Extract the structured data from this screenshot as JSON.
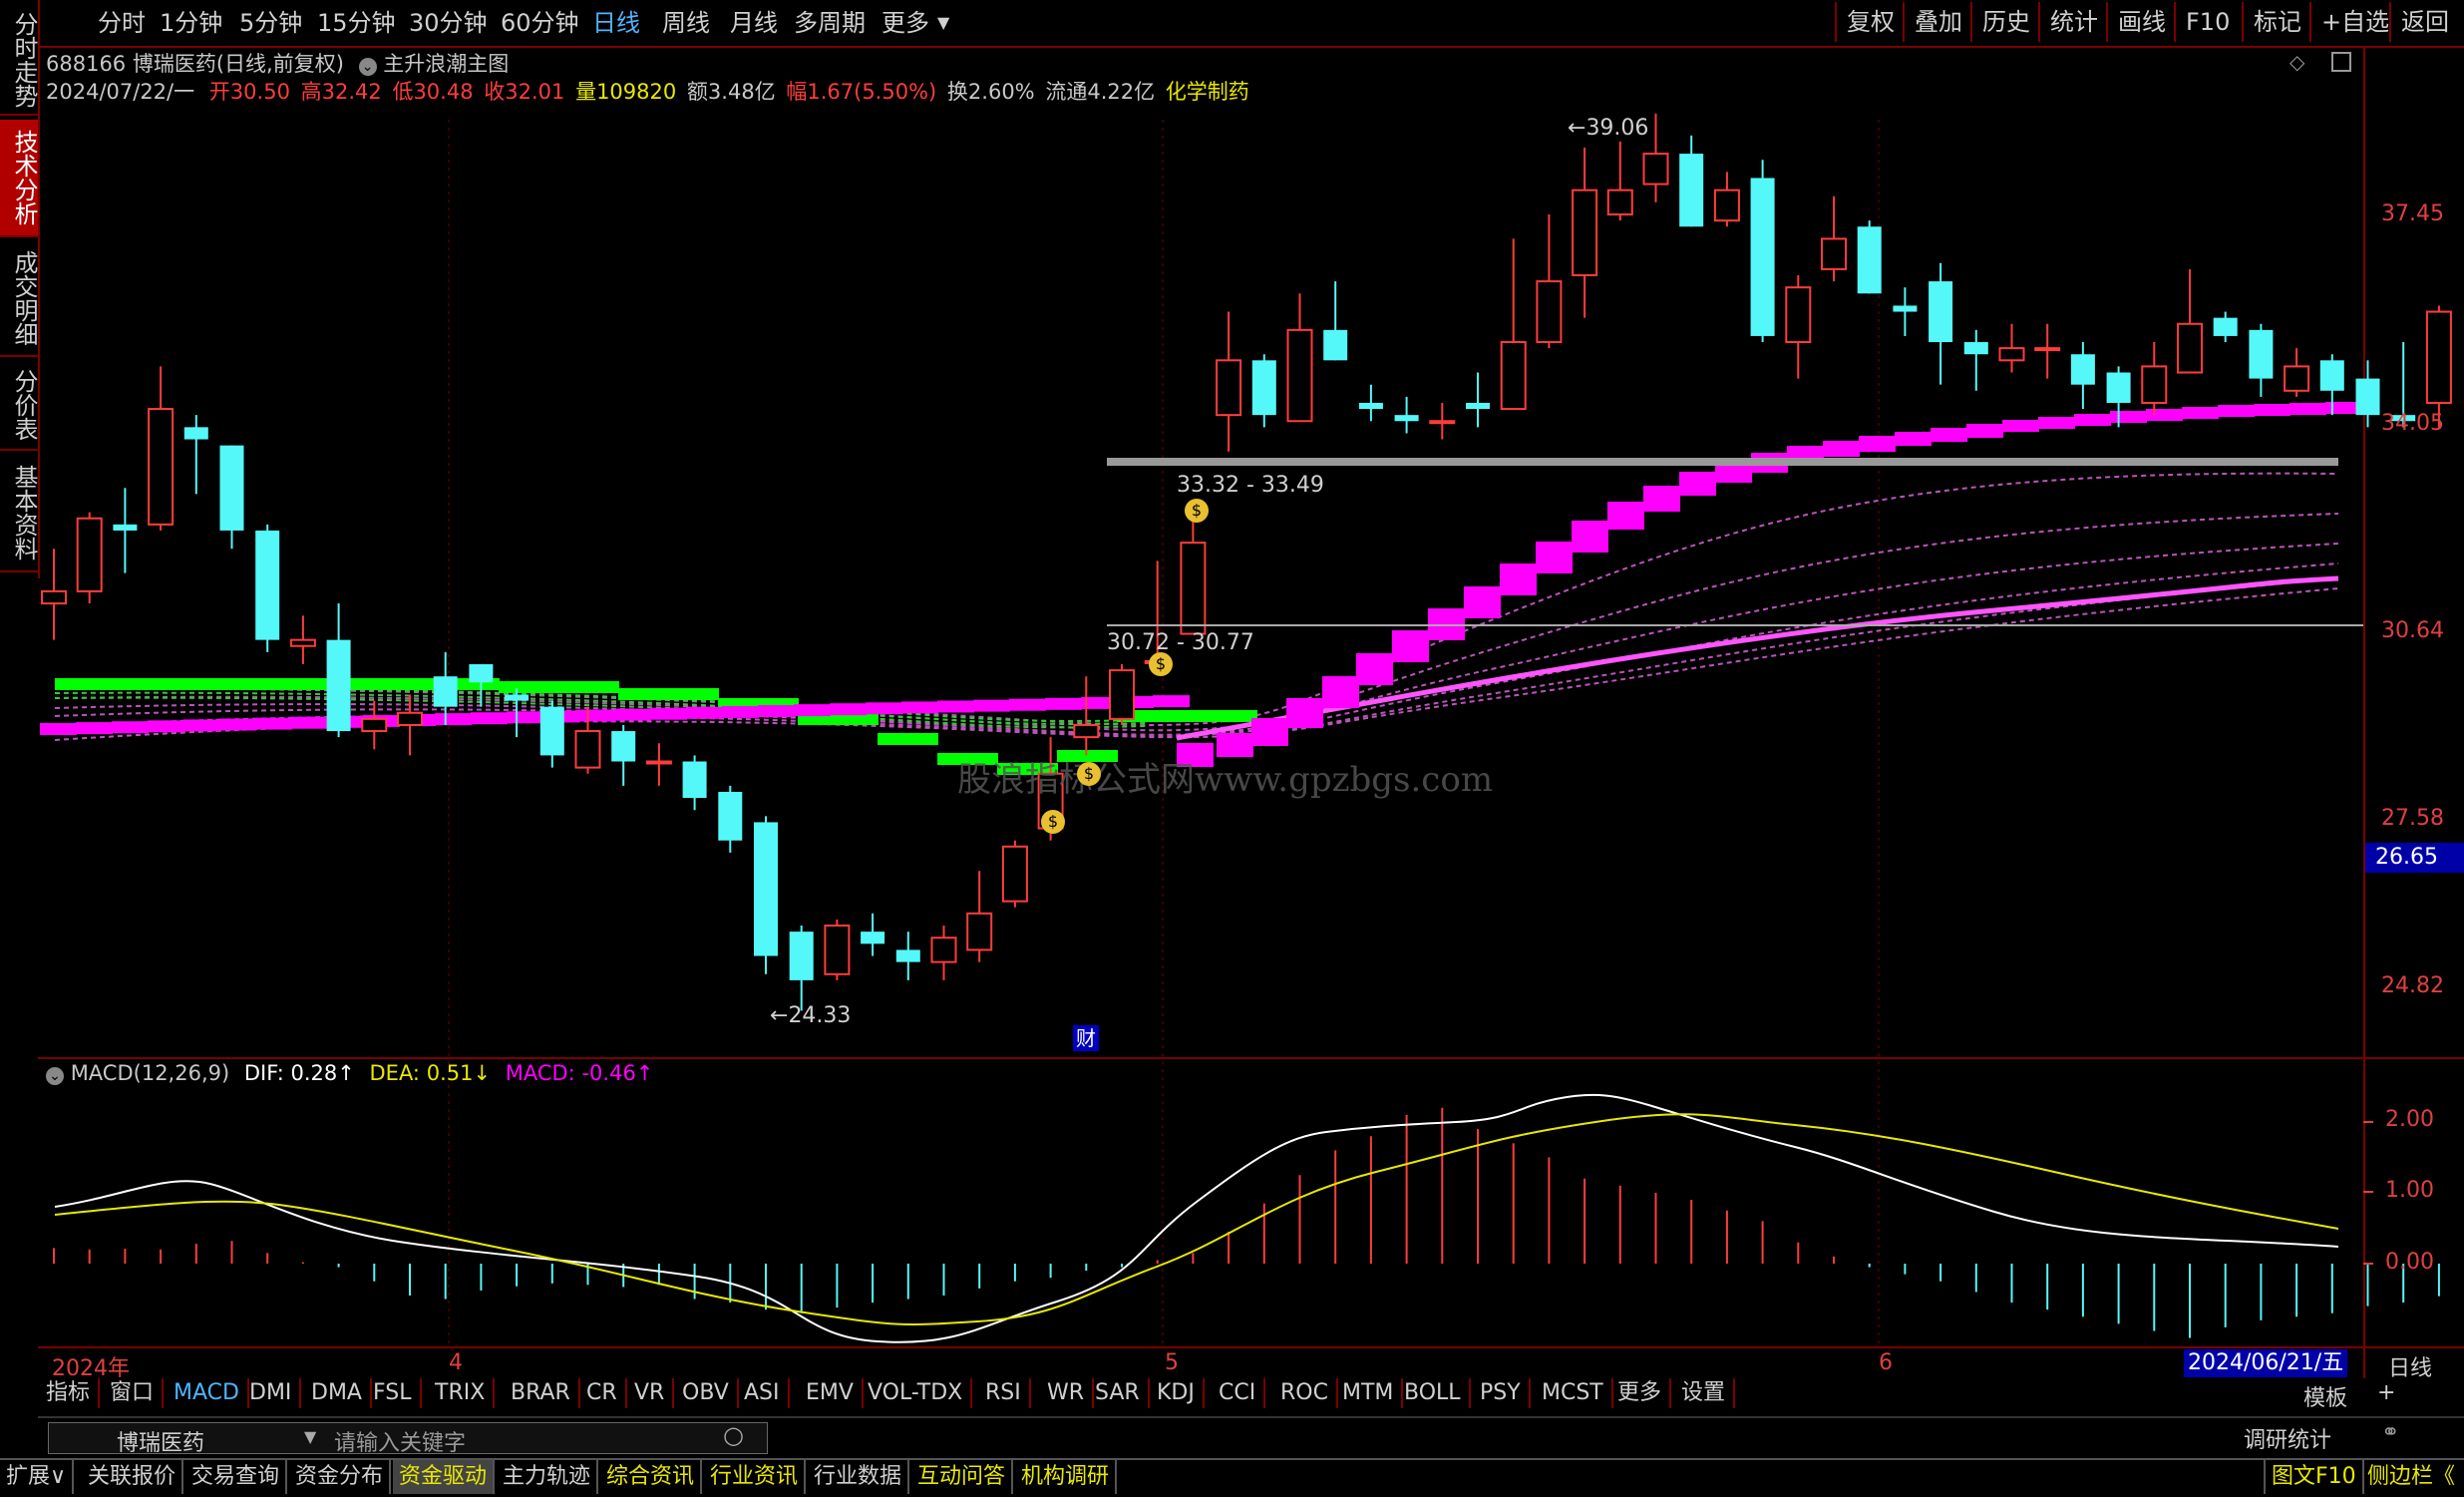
{
  "toolbar": {
    "left": [
      "分时",
      "1分钟",
      "5分钟",
      "15分钟",
      "30分钟",
      "60分钟",
      "日线",
      "周线",
      "月线",
      "多周期",
      "更多"
    ],
    "active": "日线",
    "right": [
      "复权",
      "叠加",
      "历史",
      "统计",
      "画线",
      "F10",
      "标记",
      "+自选",
      "返回"
    ]
  },
  "left_tabs": [
    "分时走势",
    "技术分析",
    "成交明细",
    "分价表",
    "基本资料"
  ],
  "left_tab_active": "技术分析",
  "stock": {
    "code_name": "688166 博瑞医药(日线,前复权)",
    "formula": "主升浪潮主图",
    "date": "2024/07/22/一",
    "open_label": "开",
    "open": "30.50",
    "high_label": "高",
    "high": "32.42",
    "low_label": "低",
    "low": "30.48",
    "close_label": "收",
    "close": "32.01",
    "vol_label": "量",
    "vol": "109820",
    "amt_label": "额",
    "amt": "3.48亿",
    "chg_label": "幅",
    "chg": "1.67(5.50%)",
    "turn_label": "换",
    "turn": "2.60%",
    "float_label": "流通",
    "float": "4.22亿",
    "sector": "化学制药"
  },
  "price_axis": [
    "37.45",
    "34.05",
    "30.64",
    "27.58",
    "24.82"
  ],
  "price_marker": "26.65",
  "annotations": {
    "high_label": "39.06",
    "low_label": "24.33",
    "range1": "33.32 - 33.49",
    "range2": "30.72 - 30.77",
    "cai": "财",
    "watermark": "股浪指标公式网www.gpzbgs.com"
  },
  "macd": {
    "title": "MACD(12,26,9)",
    "dif_label": "DIF:",
    "dif": "0.28↑",
    "dea_label": "DEA:",
    "dea": "0.51↓",
    "macd_label": "MACD:",
    "macd": "-0.46↑",
    "axis": [
      "2.00",
      "1.00",
      "0.00"
    ]
  },
  "time_axis": {
    "year": "2024年",
    "m4": "4",
    "m5": "5",
    "m6": "6",
    "cursor_date": "2024/06/21/五",
    "period": "日线"
  },
  "indicators": [
    "指标",
    "窗口",
    "MACD",
    "DMI",
    "DMA",
    "FSL",
    "TRIX",
    "BRAR",
    "CR",
    "VR",
    "OBV",
    "ASI",
    "EMV",
    "VOL-TDX",
    "RSI",
    "WR",
    "SAR",
    "KDJ",
    "CCI",
    "ROC",
    "MTM",
    "BOLL",
    "PSY",
    "MCST",
    "更多",
    "设置"
  ],
  "indicator_active": "MACD",
  "template_btn": "模板",
  "plus_btn": "+",
  "search": {
    "name": "博瑞医药",
    "placeholder": "请输入关键字",
    "right": "调研统计"
  },
  "bottom_tabs": [
    "扩展∨",
    "关联报价",
    "交易查询",
    "资金分布",
    "资金驱动",
    "主力轨迹",
    "综合资讯",
    "行业资讯",
    "行业数据",
    "互动问答",
    "机构调研"
  ],
  "bottom_right": [
    "图文F10",
    "侧边栏《"
  ],
  "colors": {
    "up": "#ff3c3c",
    "down": "#54f8f8",
    "magenta": "#ff00ff",
    "green": "#00ff00",
    "frame": "#7a0000"
  }
}
